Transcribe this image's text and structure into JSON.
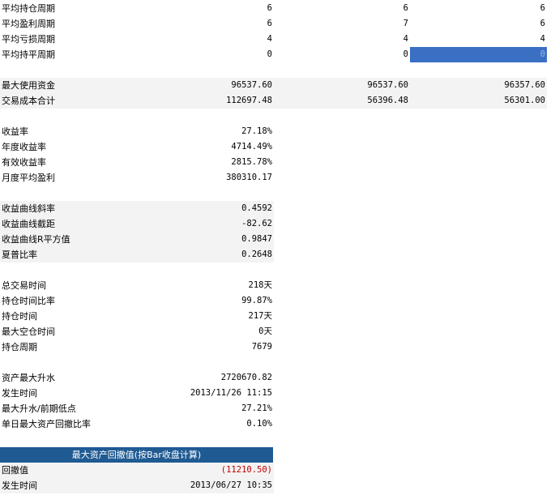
{
  "rows_top": [
    {
      "label": "平均持仓周期",
      "v1": "6",
      "v2": "6",
      "v3": "6"
    },
    {
      "label": "平均盈利周期",
      "v1": "6",
      "v2": "7",
      "v3": "6"
    },
    {
      "label": "平均亏损周期",
      "v1": "4",
      "v2": "4",
      "v3": "4"
    },
    {
      "label": "平均持平周期",
      "v1": "0",
      "v2": "0",
      "v3": "0"
    }
  ],
  "rows_capital": [
    {
      "label": "最大使用资金",
      "v1": "96537.60",
      "v2": "96537.60",
      "v3": "96357.60"
    },
    {
      "label": "交易成本合计",
      "v1": "112697.48",
      "v2": "56396.48",
      "v3": "56301.00"
    }
  ],
  "rows_return": [
    {
      "label": "收益率",
      "v1": "27.18%"
    },
    {
      "label": "年度收益率",
      "v1": "4714.49%"
    },
    {
      "label": "有效收益率",
      "v1": "2815.78%"
    },
    {
      "label": "月度平均盈利",
      "v1": "380310.17"
    }
  ],
  "rows_curve": [
    {
      "label": "收益曲线斜率",
      "v1": "0.4592"
    },
    {
      "label": "收益曲线截距",
      "v1": "-82.62"
    },
    {
      "label": "收益曲线R平方值",
      "v1": "0.9847"
    },
    {
      "label": "夏普比率",
      "v1": "0.2648"
    }
  ],
  "rows_time": [
    {
      "label": "总交易时间",
      "v1": "218天"
    },
    {
      "label": "持仓时间比率",
      "v1": "99.87%"
    },
    {
      "label": "持仓时间",
      "v1": "217天"
    },
    {
      "label": "最大空仓时间",
      "v1": "0天"
    },
    {
      "label": "持仓周期",
      "v1": "7679"
    }
  ],
  "rows_rise": [
    {
      "label": "资产最大升水",
      "v1": "2720670.82"
    },
    {
      "label": "发生时间",
      "v1": "2013/11/26 11:15"
    },
    {
      "label": "最大升水/前期低点",
      "v1": "27.21%"
    },
    {
      "label": "单日最大资产回撤比率",
      "v1": "0.10%"
    }
  ],
  "drawdown": {
    "header": "最大资产回撤值(按Bar收盘计算)",
    "rows": [
      {
        "label": "回撤值",
        "v1": "(11210.50)"
      },
      {
        "label": "发生时间",
        "v1": "2013/06/27 10:35"
      }
    ]
  }
}
